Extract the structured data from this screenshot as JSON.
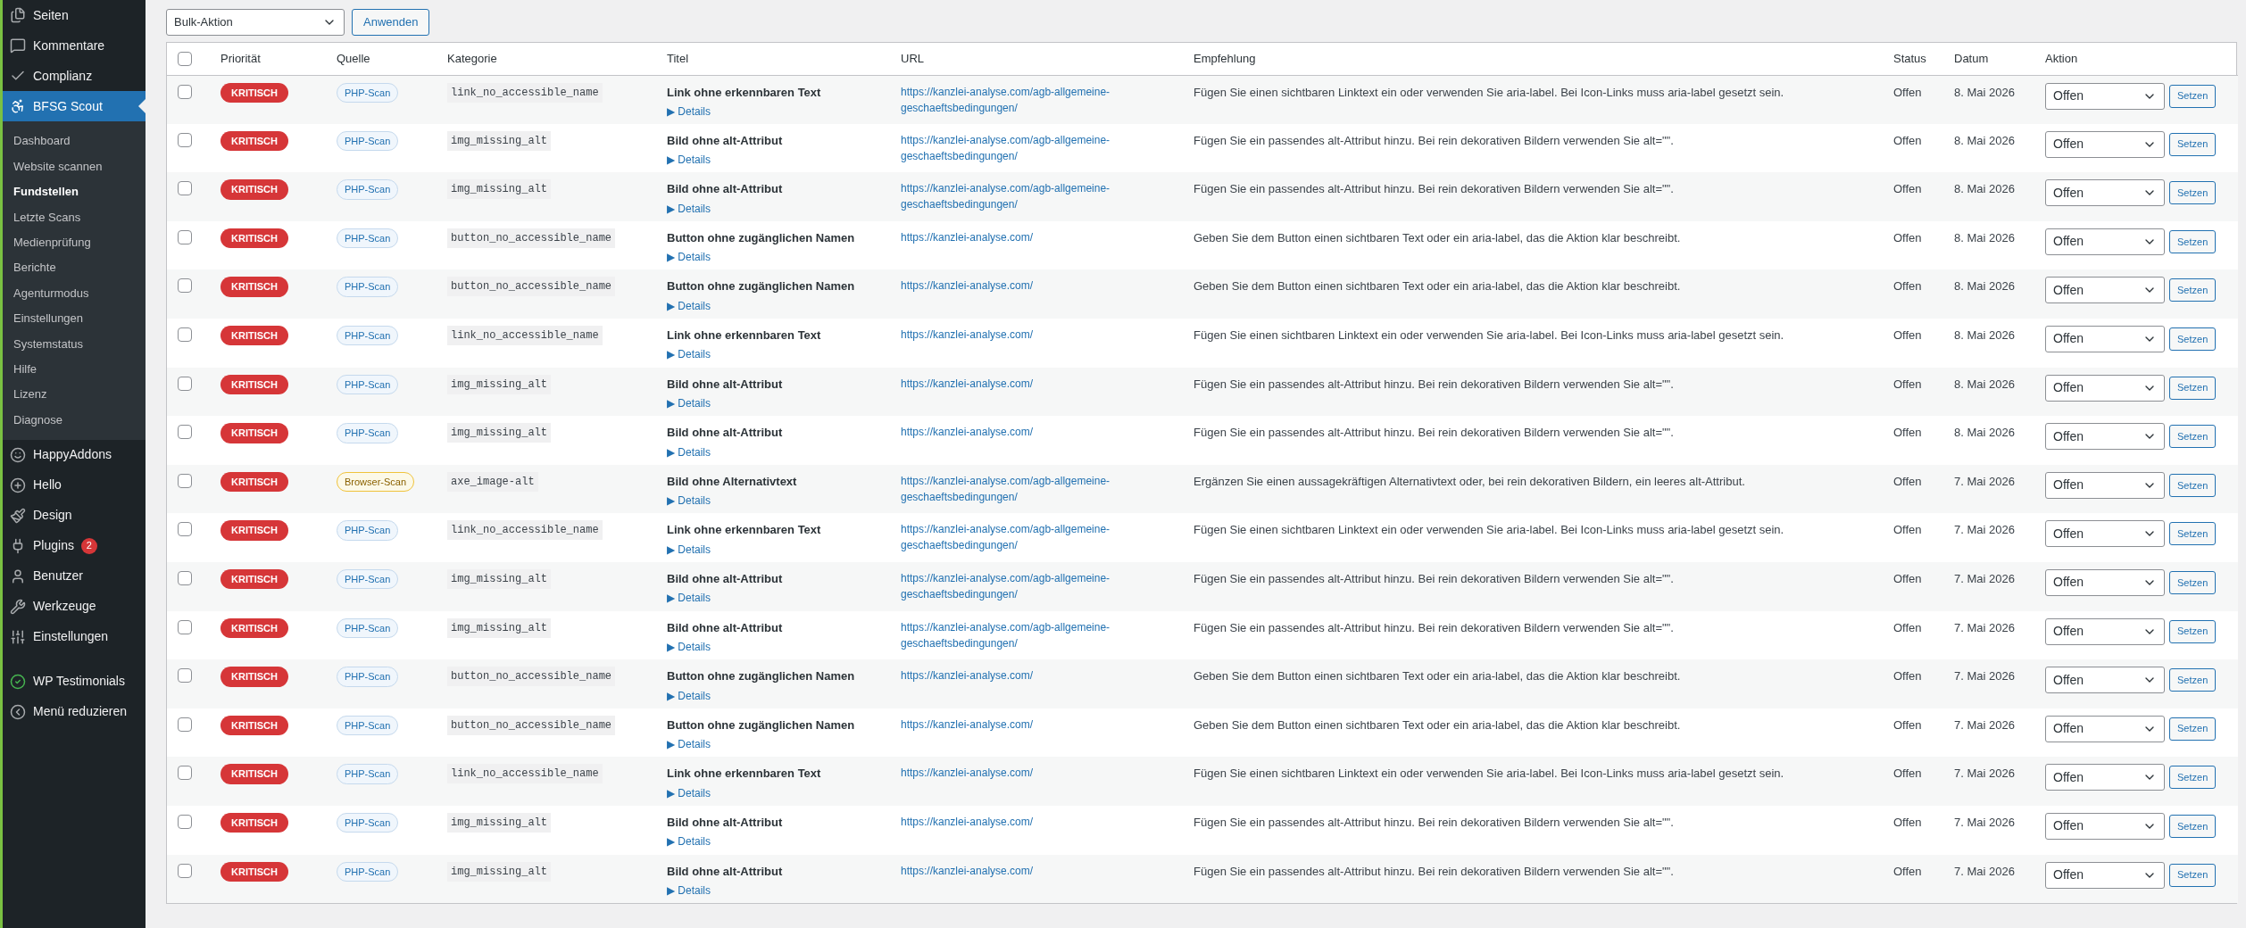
{
  "sidebar": {
    "items": [
      {
        "label": "Seiten",
        "selected": false
      },
      {
        "label": "Kommentare",
        "selected": false
      },
      {
        "label": "Complianz",
        "selected": false
      },
      {
        "label": "BFSG Scout",
        "selected": true,
        "children": [
          {
            "label": "Dashboard",
            "selected": false
          },
          {
            "label": "Website scannen",
            "selected": false
          },
          {
            "label": "Fundstellen",
            "selected": true
          },
          {
            "label": "Letzte Scans",
            "selected": false
          },
          {
            "label": "Medienprüfung",
            "selected": false
          },
          {
            "label": "Berichte",
            "selected": false
          },
          {
            "label": "Agenturmodus",
            "selected": false
          },
          {
            "label": "Einstellungen",
            "selected": false
          },
          {
            "label": "Systemstatus",
            "selected": false
          },
          {
            "label": "Hilfe",
            "selected": false
          },
          {
            "label": "Lizenz",
            "selected": false
          },
          {
            "label": "Diagnose",
            "selected": false
          }
        ]
      },
      {
        "label": "HappyAddons",
        "selected": false
      },
      {
        "label": "Hello",
        "selected": false
      },
      {
        "label": "Design",
        "selected": false
      },
      {
        "label": "Plugins",
        "selected": false,
        "badge": "2"
      },
      {
        "label": "Benutzer",
        "selected": false
      },
      {
        "label": "Werkzeuge",
        "selected": false
      },
      {
        "label": "Einstellungen",
        "selected": false
      },
      {
        "label": "WP Testimonials",
        "selected": false
      },
      {
        "label": "Menü reduzieren",
        "selected": false
      }
    ]
  },
  "toolbar": {
    "bulk_action": "Bulk-Aktion",
    "apply_button": "Anwenden"
  },
  "table": {
    "select_all_checked": false,
    "columns": [
      "Priorität",
      "Quelle",
      "Kategorie",
      "Titel",
      "URL",
      "Empfehlung",
      "Status",
      "Datum",
      "Aktion"
    ],
    "rows": [
      {
        "checked": false,
        "priority": "KRITISCH",
        "source": {
          "label": "PHP-Scan",
          "kind": "php"
        },
        "category": "link_no_accessible_name",
        "title": "Link ohne erkennbaren Text",
        "details": "▶ Details",
        "url": "https://kanzlei-analyse.com/agb-allgemeine-geschaeftsbedingungen/",
        "recommendation": "Fügen Sie einen sichtbaren Linktext ein oder verwenden Sie aria-label. Bei Icon-Links muss aria-label gesetzt sein.",
        "status": "Offen",
        "date": "8. Mai 2026",
        "action": "Offen",
        "set_button": "Setzen"
      },
      {
        "checked": false,
        "priority": "KRITISCH",
        "source": {
          "label": "PHP-Scan",
          "kind": "php"
        },
        "category": "img_missing_alt",
        "title": "Bild ohne alt-Attribut",
        "details": "▶ Details",
        "url": "https://kanzlei-analyse.com/agb-allgemeine-geschaeftsbedingungen/",
        "recommendation": "Fügen Sie ein passendes alt-Attribut hinzu. Bei rein dekorativen Bildern verwenden Sie alt=\"\".",
        "status": "Offen",
        "date": "8. Mai 2026",
        "action": "Offen",
        "set_button": "Setzen"
      },
      {
        "checked": false,
        "priority": "KRITISCH",
        "source": {
          "label": "PHP-Scan",
          "kind": "php"
        },
        "category": "img_missing_alt",
        "title": "Bild ohne alt-Attribut",
        "details": "▶ Details",
        "url": "https://kanzlei-analyse.com/agb-allgemeine-geschaeftsbedingungen/",
        "recommendation": "Fügen Sie ein passendes alt-Attribut hinzu. Bei rein dekorativen Bildern verwenden Sie alt=\"\".",
        "status": "Offen",
        "date": "8. Mai 2026",
        "action": "Offen",
        "set_button": "Setzen"
      },
      {
        "checked": false,
        "priority": "KRITISCH",
        "source": {
          "label": "PHP-Scan",
          "kind": "php"
        },
        "category": "button_no_accessible_name",
        "title": "Button ohne zugänglichen Namen",
        "details": "▶ Details",
        "url": "https://kanzlei-analyse.com/",
        "recommendation": "Geben Sie dem Button einen sichtbaren Text oder ein aria-label, das die Aktion klar beschreibt.",
        "status": "Offen",
        "date": "8. Mai 2026",
        "action": "Offen",
        "set_button": "Setzen"
      },
      {
        "checked": false,
        "priority": "KRITISCH",
        "source": {
          "label": "PHP-Scan",
          "kind": "php"
        },
        "category": "button_no_accessible_name",
        "title": "Button ohne zugänglichen Namen",
        "details": "▶ Details",
        "url": "https://kanzlei-analyse.com/",
        "recommendation": "Geben Sie dem Button einen sichtbaren Text oder ein aria-label, das die Aktion klar beschreibt.",
        "status": "Offen",
        "date": "8. Mai 2026",
        "action": "Offen",
        "set_button": "Setzen"
      },
      {
        "checked": false,
        "priority": "KRITISCH",
        "source": {
          "label": "PHP-Scan",
          "kind": "php"
        },
        "category": "link_no_accessible_name",
        "title": "Link ohne erkennbaren Text",
        "details": "▶ Details",
        "url": "https://kanzlei-analyse.com/",
        "recommendation": "Fügen Sie einen sichtbaren Linktext ein oder verwenden Sie aria-label. Bei Icon-Links muss aria-label gesetzt sein.",
        "status": "Offen",
        "date": "8. Mai 2026",
        "action": "Offen",
        "set_button": "Setzen"
      },
      {
        "checked": false,
        "priority": "KRITISCH",
        "source": {
          "label": "PHP-Scan",
          "kind": "php"
        },
        "category": "img_missing_alt",
        "title": "Bild ohne alt-Attribut",
        "details": "▶ Details",
        "url": "https://kanzlei-analyse.com/",
        "recommendation": "Fügen Sie ein passendes alt-Attribut hinzu. Bei rein dekorativen Bildern verwenden Sie alt=\"\".",
        "status": "Offen",
        "date": "8. Mai 2026",
        "action": "Offen",
        "set_button": "Setzen"
      },
      {
        "checked": false,
        "priority": "KRITISCH",
        "source": {
          "label": "PHP-Scan",
          "kind": "php"
        },
        "category": "img_missing_alt",
        "title": "Bild ohne alt-Attribut",
        "details": "▶ Details",
        "url": "https://kanzlei-analyse.com/",
        "recommendation": "Fügen Sie ein passendes alt-Attribut hinzu. Bei rein dekorativen Bildern verwenden Sie alt=\"\".",
        "status": "Offen",
        "date": "8. Mai 2026",
        "action": "Offen",
        "set_button": "Setzen"
      },
      {
        "checked": false,
        "priority": "KRITISCH",
        "source": {
          "label": "Browser-Scan",
          "kind": "browser"
        },
        "category": "axe_image-alt",
        "title": "Bild ohne Alternativtext",
        "details": "▶ Details",
        "url": "https://kanzlei-analyse.com/agb-allgemeine-geschaeftsbedingungen/",
        "recommendation": "Ergänzen Sie einen aussagekräftigen Alternativtext oder, bei rein dekorativen Bildern, ein leeres alt-Attribut.",
        "status": "Offen",
        "date": "7. Mai 2026",
        "action": "Offen",
        "set_button": "Setzen"
      },
      {
        "checked": false,
        "priority": "KRITISCH",
        "source": {
          "label": "PHP-Scan",
          "kind": "php"
        },
        "category": "link_no_accessible_name",
        "title": "Link ohne erkennbaren Text",
        "details": "▶ Details",
        "url": "https://kanzlei-analyse.com/agb-allgemeine-geschaeftsbedingungen/",
        "recommendation": "Fügen Sie einen sichtbaren Linktext ein oder verwenden Sie aria-label. Bei Icon-Links muss aria-label gesetzt sein.",
        "status": "Offen",
        "date": "7. Mai 2026",
        "action": "Offen",
        "set_button": "Setzen"
      },
      {
        "checked": false,
        "priority": "KRITISCH",
        "source": {
          "label": "PHP-Scan",
          "kind": "php"
        },
        "category": "img_missing_alt",
        "title": "Bild ohne alt-Attribut",
        "details": "▶ Details",
        "url": "https://kanzlei-analyse.com/agb-allgemeine-geschaeftsbedingungen/",
        "recommendation": "Fügen Sie ein passendes alt-Attribut hinzu. Bei rein dekorativen Bildern verwenden Sie alt=\"\".",
        "status": "Offen",
        "date": "7. Mai 2026",
        "action": "Offen",
        "set_button": "Setzen"
      },
      {
        "checked": false,
        "priority": "KRITISCH",
        "source": {
          "label": "PHP-Scan",
          "kind": "php"
        },
        "category": "img_missing_alt",
        "title": "Bild ohne alt-Attribut",
        "details": "▶ Details",
        "url": "https://kanzlei-analyse.com/agb-allgemeine-geschaeftsbedingungen/",
        "recommendation": "Fügen Sie ein passendes alt-Attribut hinzu. Bei rein dekorativen Bildern verwenden Sie alt=\"\".",
        "status": "Offen",
        "date": "7. Mai 2026",
        "action": "Offen",
        "set_button": "Setzen"
      },
      {
        "checked": false,
        "priority": "KRITISCH",
        "source": {
          "label": "PHP-Scan",
          "kind": "php"
        },
        "category": "button_no_accessible_name",
        "title": "Button ohne zugänglichen Namen",
        "details": "▶ Details",
        "url": "https://kanzlei-analyse.com/",
        "recommendation": "Geben Sie dem Button einen sichtbaren Text oder ein aria-label, das die Aktion klar beschreibt.",
        "status": "Offen",
        "date": "7. Mai 2026",
        "action": "Offen",
        "set_button": "Setzen"
      },
      {
        "checked": false,
        "priority": "KRITISCH",
        "source": {
          "label": "PHP-Scan",
          "kind": "php"
        },
        "category": "button_no_accessible_name",
        "title": "Button ohne zugänglichen Namen",
        "details": "▶ Details",
        "url": "https://kanzlei-analyse.com/",
        "recommendation": "Geben Sie dem Button einen sichtbaren Text oder ein aria-label, das die Aktion klar beschreibt.",
        "status": "Offen",
        "date": "7. Mai 2026",
        "action": "Offen",
        "set_button": "Setzen"
      },
      {
        "checked": false,
        "priority": "KRITISCH",
        "source": {
          "label": "PHP-Scan",
          "kind": "php"
        },
        "category": "link_no_accessible_name",
        "title": "Link ohne erkennbaren Text",
        "details": "▶ Details",
        "url": "https://kanzlei-analyse.com/",
        "recommendation": "Fügen Sie einen sichtbaren Linktext ein oder verwenden Sie aria-label. Bei Icon-Links muss aria-label gesetzt sein.",
        "status": "Offen",
        "date": "7. Mai 2026",
        "action": "Offen",
        "set_button": "Setzen"
      },
      {
        "checked": false,
        "priority": "KRITISCH",
        "source": {
          "label": "PHP-Scan",
          "kind": "php"
        },
        "category": "img_missing_alt",
        "title": "Bild ohne alt-Attribut",
        "details": "▶ Details",
        "url": "https://kanzlei-analyse.com/",
        "recommendation": "Fügen Sie ein passendes alt-Attribut hinzu. Bei rein dekorativen Bildern verwenden Sie alt=\"\".",
        "status": "Offen",
        "date": "7. Mai 2026",
        "action": "Offen",
        "set_button": "Setzen"
      },
      {
        "checked": false,
        "priority": "KRITISCH",
        "source": {
          "label": "PHP-Scan",
          "kind": "php"
        },
        "category": "img_missing_alt",
        "title": "Bild ohne alt-Attribut",
        "details": "▶ Details",
        "url": "https://kanzlei-analyse.com/",
        "recommendation": "Fügen Sie ein passendes alt-Attribut hinzu. Bei rein dekorativen Bildern verwenden Sie alt=\"\".",
        "status": "Offen",
        "date": "7. Mai 2026",
        "action": "Offen",
        "set_button": "Setzen"
      }
    ]
  }
}
